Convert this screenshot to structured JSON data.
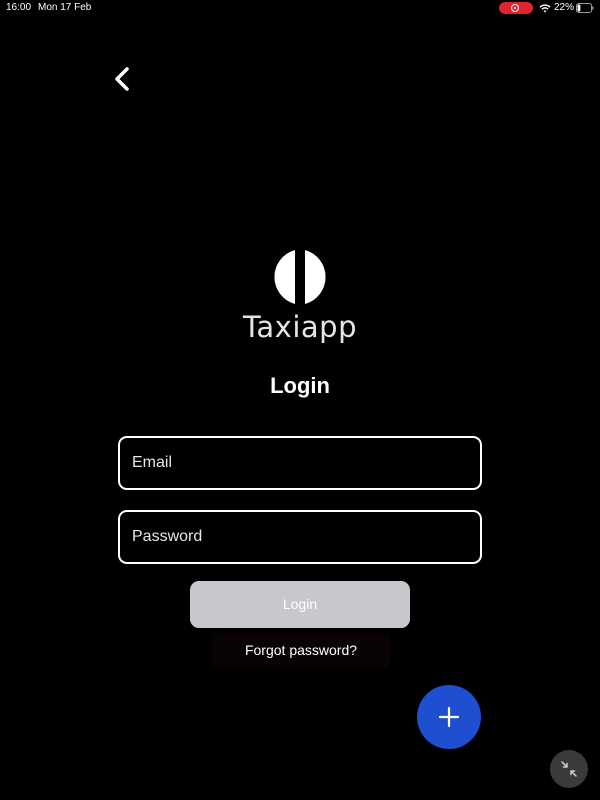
{
  "status_bar": {
    "time": "16:00",
    "date": "Mon 17 Feb",
    "battery_percent": "22%",
    "battery_level": 0.22,
    "recording_color": "#e0242e"
  },
  "header": {
    "back_icon": "chevron-left-icon"
  },
  "brand": {
    "logo_icon": "taxiapp-logo",
    "app_name": "Taxiapp"
  },
  "form": {
    "title": "Login",
    "email_placeholder": "Email",
    "email_value": "",
    "password_placeholder": "Password",
    "password_value": "",
    "login_label": "Login",
    "forgot_label": "Forgot password?"
  },
  "fab": {
    "icon": "plus-icon",
    "color": "#1f4fd1"
  },
  "overlay": {
    "icon": "minimize-arrows-icon"
  }
}
